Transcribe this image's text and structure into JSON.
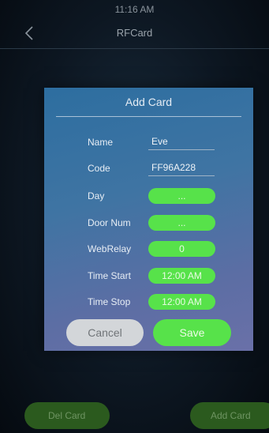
{
  "status_bar": {
    "time": "11:16 AM"
  },
  "header": {
    "title": "RFCard",
    "back_icon": "chevron-left-icon"
  },
  "dialog": {
    "title": "Add Card",
    "fields": [
      {
        "label": "Name",
        "value": "Eve"
      },
      {
        "label": "Code",
        "value": "FF96A228"
      },
      {
        "label": "Day",
        "value": "..."
      },
      {
        "label": "Door Num",
        "value": "..."
      },
      {
        "label": "WebRelay",
        "value": "0"
      },
      {
        "label": "Time Start",
        "value": "12:00 AM"
      },
      {
        "label": "Time Stop",
        "value": "12:00 AM"
      }
    ],
    "cancel_label": "Cancel",
    "save_label": "Save"
  },
  "footer": {
    "del_card_label": "Del Card",
    "add_card_label": "Add Card"
  },
  "colors": {
    "accent_green": "#57e24a",
    "dialog_blue": "#3f74a3"
  }
}
